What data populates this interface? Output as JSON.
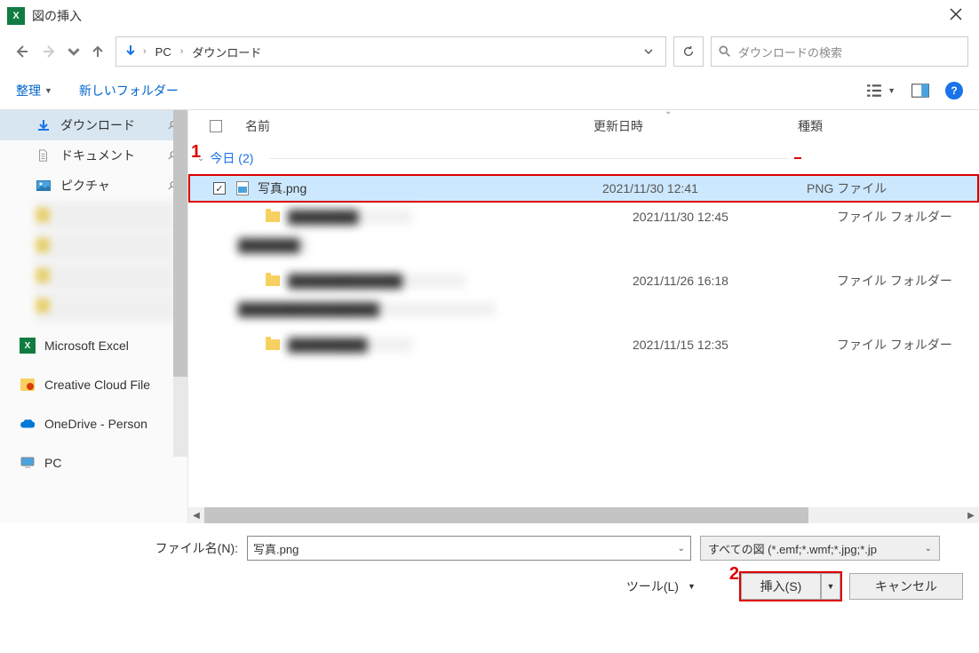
{
  "window": {
    "title": "図の挿入",
    "app_icon_text": "X"
  },
  "breadcrumb": {
    "items": [
      "PC",
      "ダウンロード"
    ]
  },
  "search": {
    "placeholder": "ダウンロードの検索"
  },
  "toolbar": {
    "organize": "整理",
    "new_folder": "新しいフォルダー"
  },
  "sidebar": {
    "downloads": "ダウンロード",
    "documents": "ドキュメント",
    "pictures": "ピクチャ",
    "excel": "Microsoft Excel",
    "ccf": "Creative Cloud File",
    "onedrive": "OneDrive - Person",
    "pc": "PC"
  },
  "columns": {
    "name": "名前",
    "date": "更新日時",
    "type": "種類"
  },
  "group_today": "今日 (2)",
  "files": [
    {
      "name": "写真.png",
      "date": "2021/11/30 12:41",
      "type": "PNG ファイル",
      "selected": true,
      "checked": true,
      "kind": "png"
    },
    {
      "name": "████████",
      "date": "2021/11/30 12:45",
      "type": "ファイル フォルダー",
      "selected": false,
      "kind": "folder",
      "blurred": true
    },
    {
      "name": "███████",
      "date": "",
      "type": "",
      "selected": false,
      "kind": "folder",
      "blurred": true
    },
    {
      "name": "█████████████",
      "date": "2021/11/26 16:18",
      "type": "ファイル フォルダー",
      "selected": false,
      "kind": "folder",
      "blurred": true
    },
    {
      "name": "████████████████",
      "date": "",
      "type": "",
      "selected": false,
      "kind": "folder",
      "blurred": true
    },
    {
      "name": "█████████",
      "date": "2021/11/15 12:35",
      "type": "ファイル フォルダー",
      "selected": false,
      "kind": "folder",
      "blurred": true
    }
  ],
  "footer": {
    "filename_label": "ファイル名(N):",
    "filename_value": "写真.png",
    "filter_label": "すべての図 (*.emf;*.wmf;*.jpg;*.jp",
    "tools": "ツール(L)",
    "insert": "挿入(S)",
    "cancel": "キャンセル"
  },
  "annotations": {
    "one": "1",
    "two": "2"
  }
}
